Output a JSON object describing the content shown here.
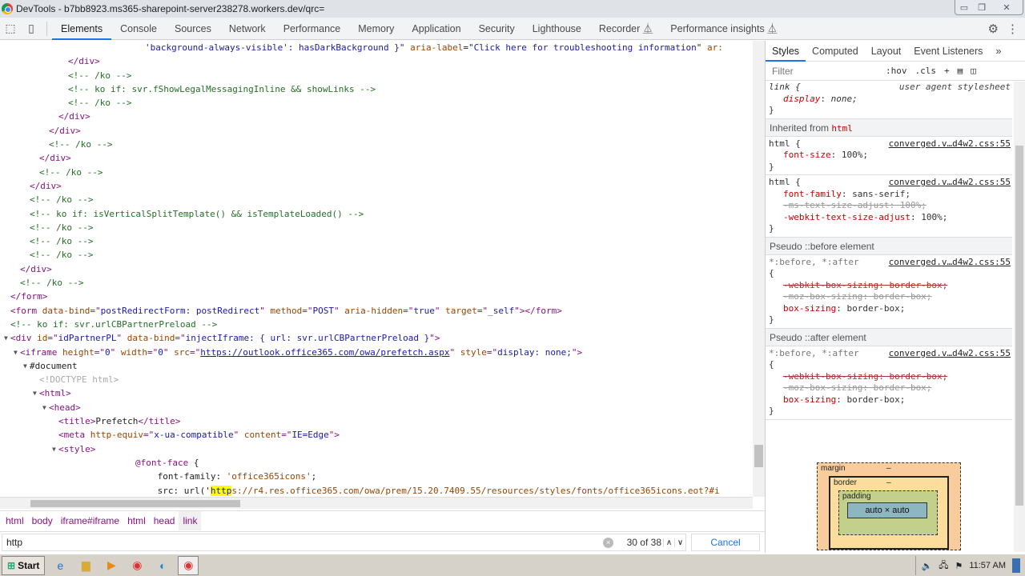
{
  "window": {
    "title": "DevTools - b7bb8923.ms365-sharepoint-server238278.workers.dev/qrc="
  },
  "toolbar": {
    "tabs": [
      "Elements",
      "Console",
      "Sources",
      "Network",
      "Performance",
      "Memory",
      "Application",
      "Security",
      "Lighthouse",
      "Recorder ⏅",
      "Performance insights ⏅"
    ],
    "active_tab": "Elements"
  },
  "elements": {
    "lines": [
      {
        "depth": 15,
        "tokens": [
          [
            "v",
            "'background-always-visible': hasDarkBackground }\""
          ],
          [
            "x",
            " "
          ],
          [
            "a",
            "aria-label"
          ],
          [
            "x",
            "=\""
          ],
          [
            "v",
            "Click here for troubleshooting information"
          ],
          [
            "x",
            "\" "
          ],
          [
            "a",
            "ar:"
          ]
        ]
      },
      {
        "depth": 7,
        "tokens": [
          [
            "t",
            "</div>"
          ]
        ]
      },
      {
        "depth": 7,
        "tokens": [
          [
            "c",
            "<!-- /ko -->"
          ]
        ]
      },
      {
        "depth": 7,
        "tokens": [
          [
            "c",
            "<!-- ko if: svr.fShowLegalMessagingInline && showLinks -->"
          ]
        ]
      },
      {
        "depth": 7,
        "tokens": [
          [
            "c",
            "<!-- /ko -->"
          ]
        ]
      },
      {
        "depth": 6,
        "tokens": [
          [
            "t",
            "</div>"
          ]
        ]
      },
      {
        "depth": 5,
        "tokens": [
          [
            "t",
            "</div>"
          ]
        ]
      },
      {
        "depth": 5,
        "tokens": [
          [
            "c",
            "<!-- /ko -->"
          ]
        ]
      },
      {
        "depth": 4,
        "tokens": [
          [
            "t",
            "</div>"
          ]
        ]
      },
      {
        "depth": 4,
        "tokens": [
          [
            "c",
            "<!-- /ko -->"
          ]
        ]
      },
      {
        "depth": 3,
        "tokens": [
          [
            "t",
            "</div>"
          ]
        ]
      },
      {
        "depth": 3,
        "tokens": [
          [
            "c",
            "<!-- /ko -->"
          ]
        ]
      },
      {
        "depth": 3,
        "tokens": [
          [
            "c",
            "<!-- ko if: isVerticalSplitTemplate() && isTemplateLoaded() -->"
          ]
        ]
      },
      {
        "depth": 3,
        "tokens": [
          [
            "c",
            "<!-- /ko -->"
          ]
        ]
      },
      {
        "depth": 3,
        "tokens": [
          [
            "c",
            "<!-- /ko -->"
          ]
        ]
      },
      {
        "depth": 3,
        "tokens": [
          [
            "c",
            "<!-- /ko -->"
          ]
        ]
      },
      {
        "depth": 2,
        "tokens": [
          [
            "t",
            "</div>"
          ]
        ]
      },
      {
        "depth": 2,
        "tokens": [
          [
            "c",
            "<!-- /ko -->"
          ]
        ]
      },
      {
        "depth": 1,
        "tokens": [
          [
            "t",
            "</form>"
          ]
        ]
      },
      {
        "depth": 1,
        "tokens": [
          [
            "t",
            "<form "
          ],
          [
            "a",
            "data-bind"
          ],
          [
            "t",
            "=\""
          ],
          [
            "v",
            "postRedirectForm: postRedirect"
          ],
          [
            "t",
            "\" "
          ],
          [
            "a",
            "method"
          ],
          [
            "t",
            "=\""
          ],
          [
            "v",
            "POST"
          ],
          [
            "t",
            "\" "
          ],
          [
            "a",
            "aria-hidden"
          ],
          [
            "t",
            "=\""
          ],
          [
            "v",
            "true"
          ],
          [
            "t",
            "\" "
          ],
          [
            "a",
            "target"
          ],
          [
            "t",
            "=\""
          ],
          [
            "v",
            "_self"
          ],
          [
            "t",
            "\"></form>"
          ]
        ]
      },
      {
        "depth": 1,
        "tokens": [
          [
            "c",
            "<!-- ko if: svr.urlCBPartnerPreload -->"
          ]
        ]
      },
      {
        "depth": 1,
        "expanded": true,
        "tokens": [
          [
            "t",
            "<div "
          ],
          [
            "a",
            "id"
          ],
          [
            "t",
            "=\""
          ],
          [
            "v",
            "idPartnerPL"
          ],
          [
            "t",
            "\" "
          ],
          [
            "a",
            "data-bind"
          ],
          [
            "t",
            "=\""
          ],
          [
            "v",
            "injectIframe: { url: svr.urlCBPartnerPreload }"
          ],
          [
            "t",
            "\">"
          ]
        ]
      },
      {
        "depth": 2,
        "expanded": true,
        "tokens": [
          [
            "t",
            "<iframe "
          ],
          [
            "a",
            "height"
          ],
          [
            "t",
            "=\""
          ],
          [
            "v",
            "0"
          ],
          [
            "t",
            "\" "
          ],
          [
            "a",
            "width"
          ],
          [
            "t",
            "=\""
          ],
          [
            "v",
            "0"
          ],
          [
            "t",
            "\" "
          ],
          [
            "a",
            "src"
          ],
          [
            "t",
            "=\""
          ],
          [
            "l",
            "https://outlook.office365.com/owa/prefetch.aspx"
          ],
          [
            "t",
            "\" "
          ],
          [
            "a",
            "style"
          ],
          [
            "t",
            "=\""
          ],
          [
            "v",
            "display: none;"
          ],
          [
            "t",
            "\">"
          ]
        ]
      },
      {
        "depth": 3,
        "expanded": true,
        "tokens": [
          [
            "x",
            "#document"
          ]
        ]
      },
      {
        "depth": 4,
        "tokens": [
          [
            "g",
            "<!DOCTYPE html>"
          ]
        ]
      },
      {
        "depth": 4,
        "expanded": true,
        "tokens": [
          [
            "t",
            "<html>"
          ]
        ]
      },
      {
        "depth": 5,
        "expanded": true,
        "tokens": [
          [
            "t",
            "<head>"
          ]
        ]
      },
      {
        "depth": 6,
        "tokens": [
          [
            "t",
            "<title>"
          ],
          [
            "x",
            "Prefetch"
          ],
          [
            "t",
            "</title>"
          ]
        ]
      },
      {
        "depth": 6,
        "tokens": [
          [
            "t",
            "<meta "
          ],
          [
            "a",
            "http-equiv"
          ],
          [
            "t",
            "=\""
          ],
          [
            "v",
            "x-ua-compatible"
          ],
          [
            "t",
            "\" "
          ],
          [
            "a",
            "content"
          ],
          [
            "t",
            "=\""
          ],
          [
            "v",
            "IE=Edge"
          ],
          [
            "t",
            "\">"
          ]
        ]
      },
      {
        "depth": 6,
        "expanded": true,
        "tokens": [
          [
            "t",
            "<style>"
          ]
        ]
      },
      {
        "depth": 14,
        "tokens": [
          [
            "t",
            "@font-face"
          ],
          [
            "x",
            " {"
          ]
        ]
      },
      {
        "depth": 16.3,
        "tokens": [
          [
            "x",
            "font-family: "
          ],
          [
            "a",
            "'office365icons'"
          ],
          [
            "x",
            ";"
          ]
        ]
      },
      {
        "depth": 16.3,
        "tokens": [
          [
            "x",
            "src: url('"
          ],
          [
            "h",
            "http"
          ],
          [
            "a",
            "s://r4.res.office365.com/owa/prem/15.20.7409.55/resources/styles/fonts/office365icons.eot?#i"
          ]
        ]
      }
    ]
  },
  "breadcrumbs": [
    "html",
    "body",
    "iframe#iframe",
    "html",
    "head",
    "link"
  ],
  "search": {
    "value": "http",
    "count": "30 of 38",
    "cancel": "Cancel"
  },
  "sidebar": {
    "tabs": [
      "Styles",
      "Computed",
      "Layout",
      "Event Listeners",
      "»"
    ],
    "filter_placeholder": "Filter",
    "hov": ":hov",
    "cls": ".cls",
    "sections": {
      "inherited_label": "Inherited from",
      "inherited_el": "html",
      "before_label": "Pseudo ::before element",
      "after_label": "Pseudo ::after element"
    },
    "rules": {
      "link_selector": "link {",
      "link_source": "user agent stylesheet",
      "link_prop": "display",
      "link_val": " none;",
      "source": "converged.v…d4w2.css:55",
      "html1_selector": "html {",
      "html1_prop": "font-size",
      "html1_val": " 100%;",
      "html2_selector": "html {",
      "html2_p1": "font-family",
      "html2_v1": " sans-serif;",
      "html2_p2": "-ms-text-size-adjust: 100%;",
      "html2_p3": "-webkit-text-size-adjust",
      "html2_v3": " 100%;",
      "pseudo_selector": "*:before, *:after",
      "brace_open": "{",
      "brace_close": "}",
      "ps_p1": "-webkit-box-sizing: border-box;",
      "ps_p2": "-moz-box-sizing: border-box;",
      "ps_p3": "box-sizing",
      "ps_v3": " border-box;"
    },
    "box_model": {
      "margin": "margin",
      "border": "border",
      "padding": "padding",
      "content": "auto × auto",
      "dash": "–"
    }
  },
  "taskbar": {
    "start": "Start",
    "time": "11:57 AM"
  }
}
